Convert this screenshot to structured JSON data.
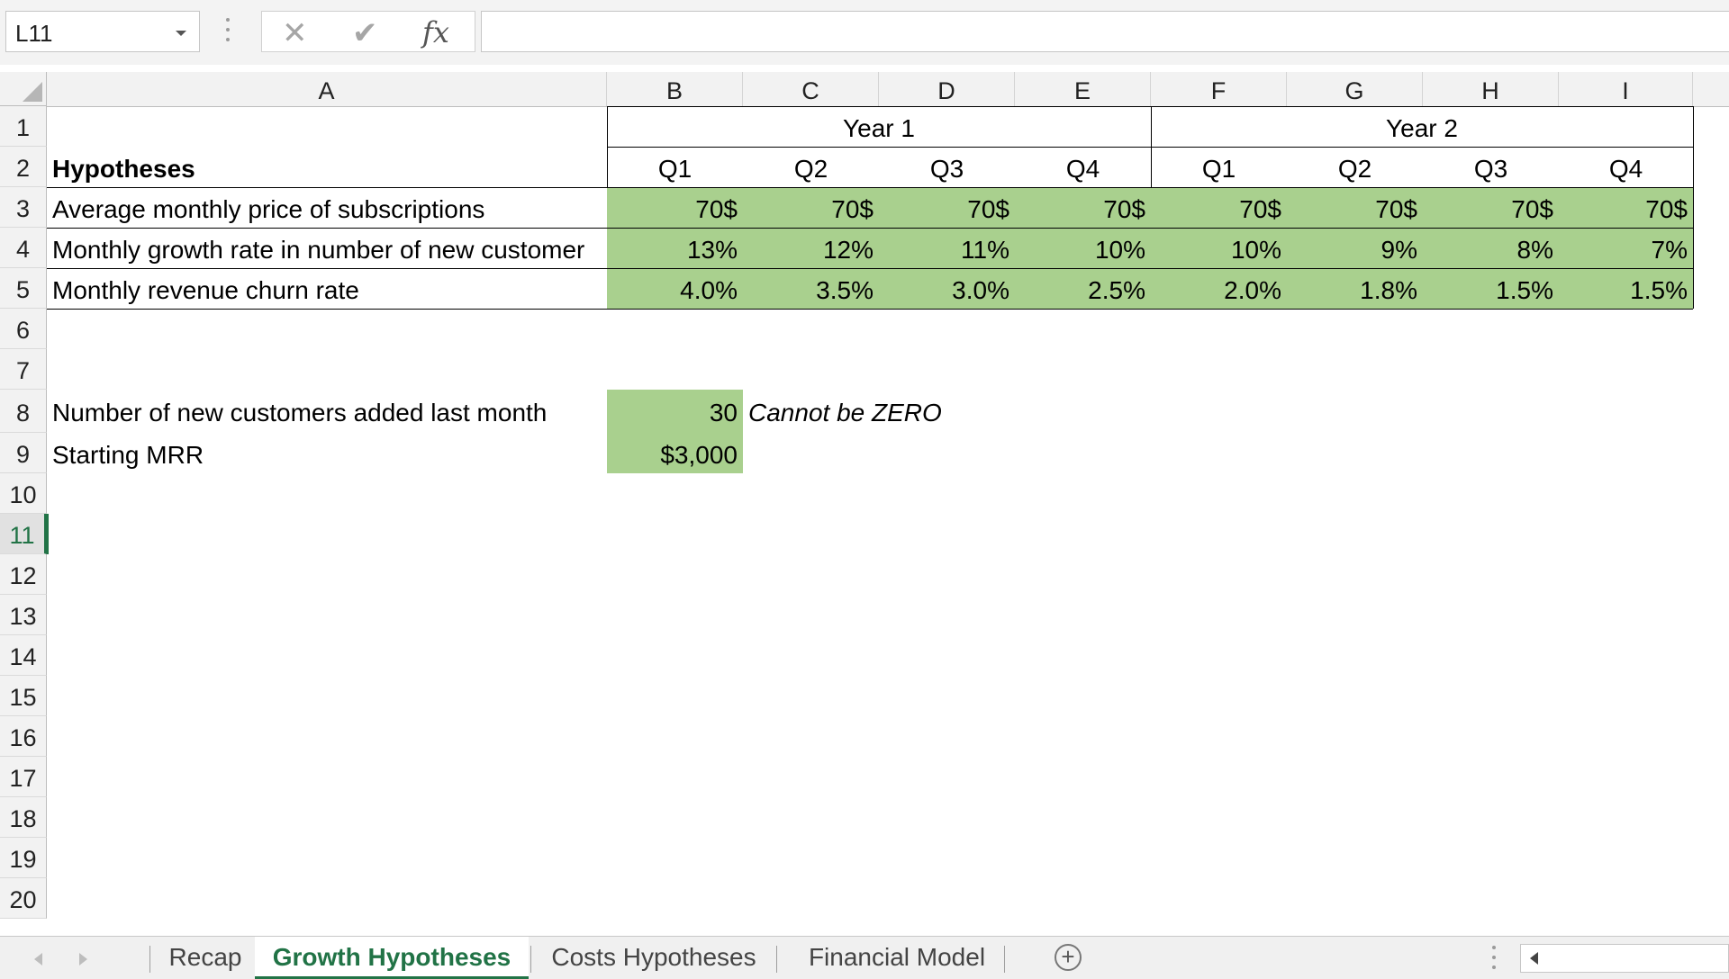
{
  "formula_bar": {
    "name_box": "L11",
    "cancel_icon": "cross-icon",
    "enter_icon": "check-icon",
    "fx_label": "fx",
    "formula": ""
  },
  "columns": [
    "A",
    "B",
    "C",
    "D",
    "E",
    "F",
    "G",
    "H",
    "I"
  ],
  "rows": [
    "1",
    "2",
    "3",
    "4",
    "5",
    "6",
    "7",
    "8",
    "9",
    "10",
    "11",
    "12",
    "13",
    "14",
    "15",
    "16",
    "17",
    "18",
    "19",
    "20"
  ],
  "selected_row": "11",
  "sheet": {
    "year1": "Year 1",
    "year2": "Year 2",
    "hypotheses_label": "Hypotheses",
    "quarters": [
      "Q1",
      "Q2",
      "Q3",
      "Q4",
      "Q1",
      "Q2",
      "Q3",
      "Q4"
    ],
    "data_rows": [
      {
        "label": "Average monthly price of subscriptions",
        "values": [
          "70$",
          "70$",
          "70$",
          "70$",
          "70$",
          "70$",
          "70$",
          "70$"
        ]
      },
      {
        "label": "Monthly growth rate in number of new customer",
        "values": [
          "13%",
          "12%",
          "11%",
          "10%",
          "10%",
          "9%",
          "8%",
          "7%"
        ]
      },
      {
        "label": "Monthly revenue churn rate",
        "values": [
          "4.0%",
          "3.5%",
          "3.0%",
          "2.5%",
          "2.0%",
          "1.8%",
          "1.5%",
          "1.5%"
        ]
      }
    ],
    "new_customers_label": "Number of new customers added last month",
    "new_customers_value": "30",
    "new_customers_note": "Cannot be ZERO",
    "starting_mrr_label": "Starting MRR",
    "starting_mrr_value": "$3,000"
  },
  "tabs": {
    "items": [
      "Recap",
      "Growth Hypotheses",
      "Costs Hypotheses",
      "Financial Model"
    ],
    "active": "Growth Hypotheses",
    "add_icon": "plus-circle-icon"
  },
  "colors": {
    "input_fill": "#a9d08e",
    "accent": "#217346"
  }
}
